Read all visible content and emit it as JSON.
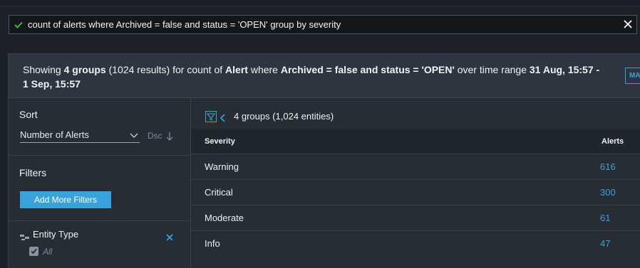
{
  "query_bar": {
    "text": "count of alerts where Archived = false and status = 'OPEN' group by severity"
  },
  "summary": {
    "prefix": "Showing ",
    "groups": "4 groups",
    "mid1": " (1024 results) for count of ",
    "entity": "Alert",
    "mid2": " where ",
    "condition": "Archived = false and status = 'OPEN'",
    "mid3": " over time range ",
    "range": "31 Aug, 15:57 - 1 Sep, 15:57",
    "button_label": "MA"
  },
  "sidebar": {
    "sort_title": "Sort",
    "sort_value": "Number of Alerts",
    "sort_direction": "Dsc",
    "filters_title": "Filters",
    "add_filters_label": "Add More Filters",
    "entity_type_label": "Entity Type",
    "entity_type_value": "All"
  },
  "main": {
    "groups_summary": "4 groups (1,024 entities)",
    "columns": {
      "severity": "Severity",
      "alerts": "Alerts"
    },
    "rows": [
      {
        "severity": "Warning",
        "alerts": "616"
      },
      {
        "severity": "Critical",
        "alerts": "300"
      },
      {
        "severity": "Moderate",
        "alerts": "61"
      },
      {
        "severity": "Info",
        "alerts": "47"
      }
    ]
  },
  "colors": {
    "accent": "#39a2da",
    "success": "#4caf50"
  }
}
